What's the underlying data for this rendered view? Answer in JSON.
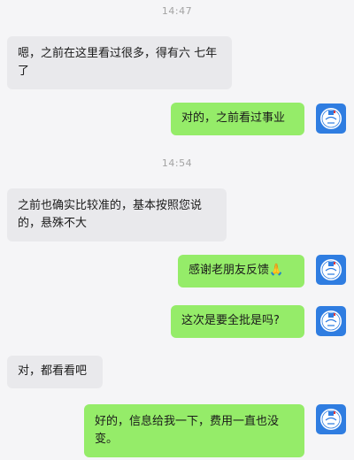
{
  "chat": {
    "timestamps": [
      "14:47",
      "14:54"
    ],
    "messages": [
      {
        "side": "in",
        "text": "嗯，之前在这里看过很多，得有六 七年了"
      },
      {
        "side": "out",
        "text": "对的，之前看过事业"
      },
      {
        "side": "in",
        "text": "之前也确实比较准的，基本按照您说的，悬殊不大"
      },
      {
        "side": "out",
        "text": "感谢老朋友反馈🙏"
      },
      {
        "side": "out",
        "text": "这次是要全批是吗?"
      },
      {
        "side": "in",
        "text": "对，都看看吧"
      },
      {
        "side": "out",
        "text": "好的，信息给我一下，费用一直也没变。"
      }
    ]
  },
  "colors": {
    "incoming_bubble": "#e9e9ec",
    "outgoing_bubble": "#95ec69",
    "avatar_bg": "#2f7de1",
    "background": "#f5f5f7"
  },
  "icons": {
    "avatar": "circular-seal-logo-icon"
  }
}
